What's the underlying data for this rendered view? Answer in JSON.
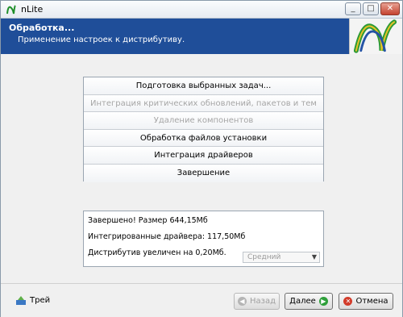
{
  "window": {
    "title": "nLite"
  },
  "header": {
    "title": "Обработка...",
    "subtitle": "Применение настроек к дистрибутиву."
  },
  "tasks": [
    {
      "label": "Подготовка выбранных задач...",
      "enabled": true
    },
    {
      "label": "Интеграция критических обновлений, пакетов и тем",
      "enabled": false
    },
    {
      "label": "Удаление компонентов",
      "enabled": false
    },
    {
      "label": "Обработка файлов установки",
      "enabled": true
    },
    {
      "label": "Интеграция драйверов",
      "enabled": true
    },
    {
      "label": "Завершение",
      "enabled": true
    }
  ],
  "log": {
    "lines": [
      "Завершено! Размер 644,15Мб",
      "Интегрированные драйвера: 117,50Мб",
      "Дистрибутив увеличен на 0,20Мб."
    ],
    "priority": "Средний"
  },
  "footer": {
    "tray_label": "Трей",
    "back_label": "Назад",
    "next_label": "Далее",
    "cancel_label": "Отмена"
  },
  "colors": {
    "header_bg": "#1f4e99",
    "disabled_text": "#a5a5a5",
    "next_icon": "#2e9f3a",
    "cancel_icon": "#d23b2a"
  }
}
